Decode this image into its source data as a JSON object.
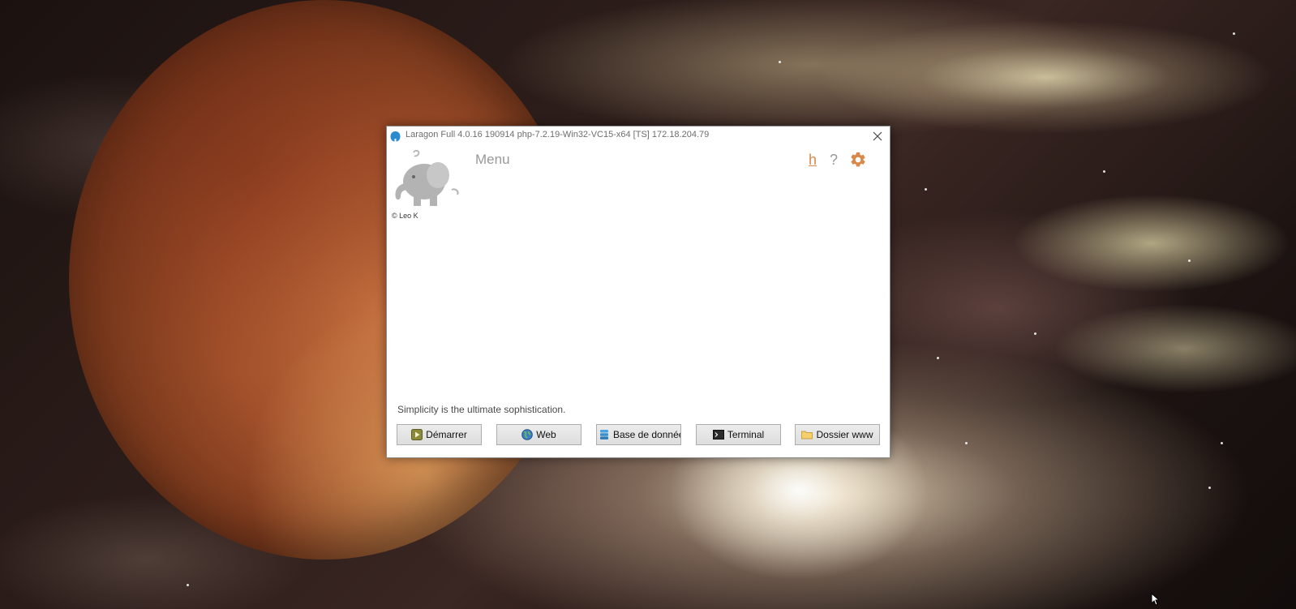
{
  "window": {
    "title": "Laragon Full 4.0.16 190914 php-7.2.19-Win32-VC15-x64 [TS]  172.18.204.79",
    "close_label": "✕"
  },
  "header": {
    "menu_label": "Menu",
    "copyright": "© Leo K",
    "link_h": "h",
    "link_help": "?"
  },
  "main": {
    "tagline": "Simplicity is the ultimate sophistication."
  },
  "buttons": {
    "start": {
      "label": "Démarrer",
      "icon": "play-icon"
    },
    "web": {
      "label": "Web",
      "icon": "globe-icon"
    },
    "database": {
      "label": "Base de données",
      "icon": "database-icon"
    },
    "terminal": {
      "label": "Terminal",
      "icon": "terminal-icon"
    },
    "www_folder": {
      "label": "Dossier www",
      "icon": "folder-icon"
    }
  },
  "colors": {
    "accent": "#d9884a",
    "muted": "#999999",
    "title_text": "#6d6d6d"
  }
}
